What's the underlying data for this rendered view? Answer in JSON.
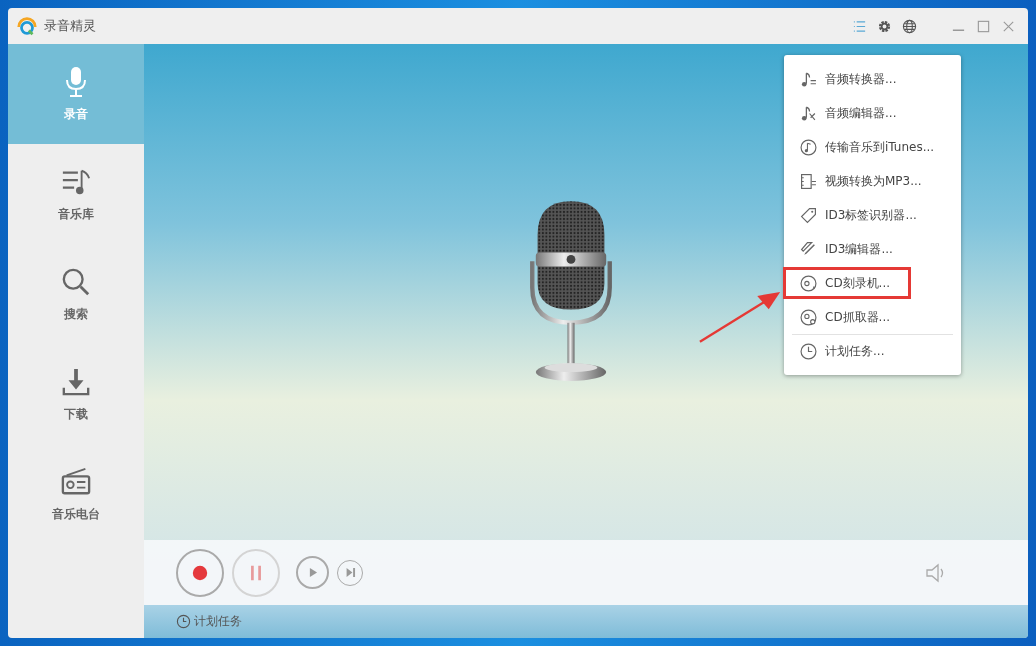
{
  "window": {
    "title": "录音精灵"
  },
  "sidebar": {
    "items": [
      {
        "label": "录音",
        "selected": true
      },
      {
        "label": "音乐库",
        "selected": false
      },
      {
        "label": "搜索",
        "selected": false
      },
      {
        "label": "下载",
        "selected": false
      },
      {
        "label": "音乐电台",
        "selected": false
      }
    ]
  },
  "menu": {
    "items": [
      {
        "label": "音频转换器...",
        "highlighted": false,
        "separator_before": false
      },
      {
        "label": "音频编辑器...",
        "highlighted": false,
        "separator_before": false
      },
      {
        "label": "传输音乐到iTunes...",
        "highlighted": false,
        "separator_before": false
      },
      {
        "label": "视频转换为MP3...",
        "highlighted": false,
        "separator_before": false
      },
      {
        "label": "ID3标签识别器...",
        "highlighted": false,
        "separator_before": false
      },
      {
        "label": "ID3编辑器...",
        "highlighted": false,
        "separator_before": false
      },
      {
        "label": "CD刻录机...",
        "highlighted": true,
        "separator_before": false
      },
      {
        "label": "CD抓取器...",
        "highlighted": false,
        "separator_before": false
      },
      {
        "label": "计划任务...",
        "highlighted": false,
        "separator_before": true
      }
    ]
  },
  "status_bar": {
    "schedule": "计划任务"
  }
}
